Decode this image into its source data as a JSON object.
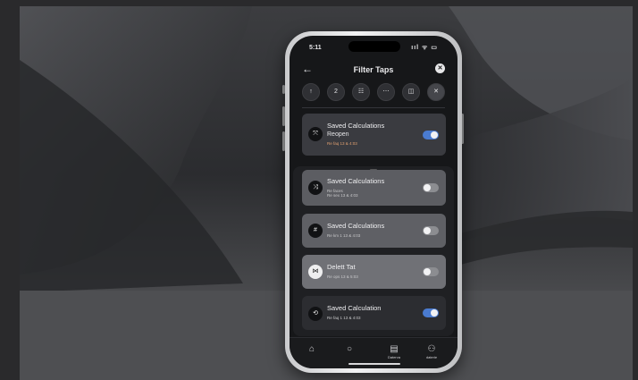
{
  "status": {
    "time": "5:11",
    "icons": "ııl ᯤ ▭"
  },
  "header": {
    "back": "←",
    "title": "Filter Taps",
    "close": "✕"
  },
  "chips": [
    "↑",
    "2",
    "☷",
    "⋯",
    "◫",
    "✕"
  ],
  "cards": [
    {
      "icon": "⤧",
      "title": "Saved Calculations",
      "title2": "Reopen",
      "sub": "Re faq  13 & 4:03",
      "toggle": "on"
    },
    {
      "icon": "⤨",
      "title": "Saved Calculations",
      "title2": "",
      "sub": "Re faces\nRe sex 13 & 4:03",
      "toggle": "off"
    },
    {
      "icon": "#",
      "title": "Saved Calculations",
      "title2": "",
      "sub": "Re km 1 13 & 4:03",
      "toggle": "off"
    },
    {
      "icon": "⋈",
      "title": "Delett Tat",
      "title2": "",
      "sub": "Re ops 13 & 5:03",
      "toggle": "off"
    },
    {
      "icon": "⟲",
      "title": "Saved Calculation",
      "title2": "",
      "sub": "Re faq 1 13 & 4:03",
      "toggle": "on"
    }
  ],
  "tabs": [
    {
      "icon": "⌂",
      "label": ""
    },
    {
      "icon": "○",
      "label": ""
    },
    {
      "icon": "▤",
      "label": "Daterva"
    },
    {
      "icon": "⚇",
      "label": "daterie"
    }
  ]
}
